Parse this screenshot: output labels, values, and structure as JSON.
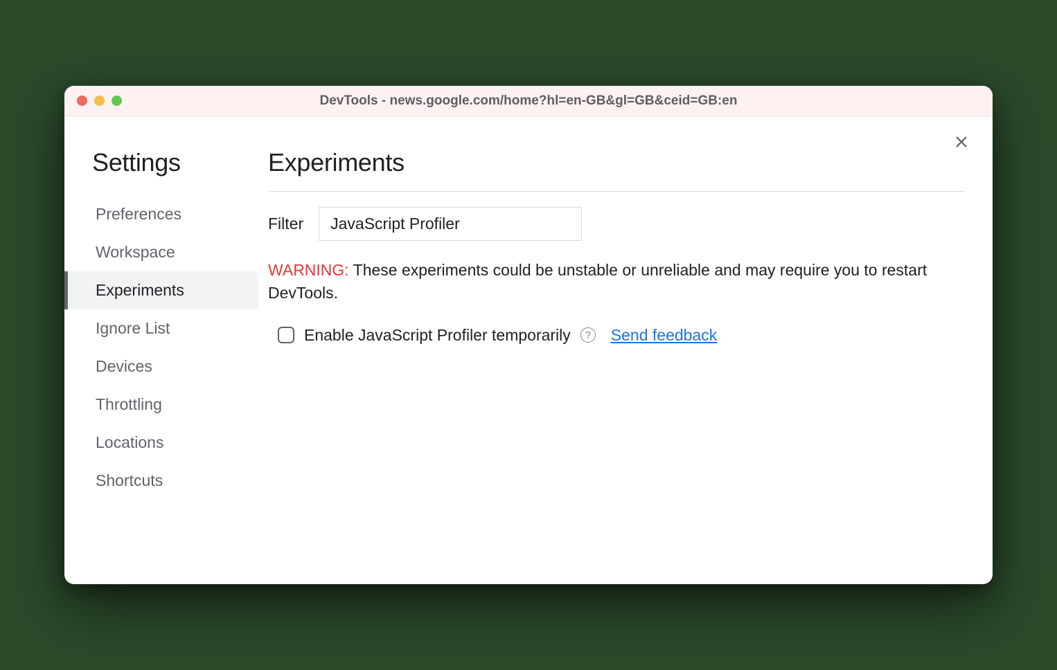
{
  "window": {
    "title": "DevTools - news.google.com/home?hl=en-GB&gl=GB&ceid=GB:en"
  },
  "sidebar": {
    "title": "Settings",
    "items": [
      {
        "label": "Preferences",
        "active": false
      },
      {
        "label": "Workspace",
        "active": false
      },
      {
        "label": "Experiments",
        "active": true
      },
      {
        "label": "Ignore List",
        "active": false
      },
      {
        "label": "Devices",
        "active": false
      },
      {
        "label": "Throttling",
        "active": false
      },
      {
        "label": "Locations",
        "active": false
      },
      {
        "label": "Shortcuts",
        "active": false
      }
    ]
  },
  "main": {
    "heading": "Experiments",
    "filter_label": "Filter",
    "filter_value": "JavaScript Profiler",
    "warning_label": "WARNING:",
    "warning_text": " These experiments could be unstable or unreliable and may require you to restart DevTools.",
    "experiment": {
      "checked": false,
      "label": "Enable JavaScript Profiler temporarily",
      "help_glyph": "?",
      "feedback_label": "Send feedback"
    }
  }
}
